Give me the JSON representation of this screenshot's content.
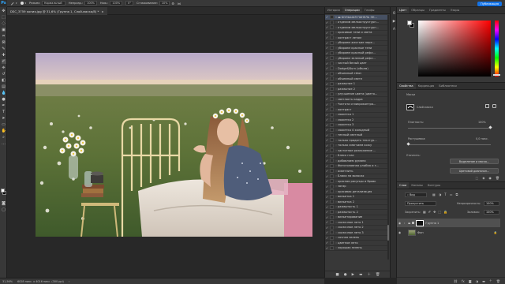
{
  "options_bar": {
    "app_logo": "Ps",
    "mode_label": "Режим:",
    "mode_value": "Нормальный",
    "opacity_label": "Непрозр.:",
    "opacity_value": "100%",
    "pressure_label": "Наж.:",
    "pressure_value": "100%",
    "angle_value": "0°",
    "smoothing_label": "Сглаживание:",
    "smoothing_value": "10%",
    "share_label": "Публикация"
  },
  "document": {
    "tab_title": "DSC_3759 копия.jpg @ 31,6% (Группа 1, Слой-маска/8) *",
    "zoom": "31,56%",
    "dimensions": "6028 пикс. x 4016 пикс. (300 ppi)"
  },
  "actions_panel": {
    "tabs": [
      "История",
      "Операции",
      "Глифы"
    ],
    "active_tab": "Операции",
    "folder_name": "БОЛЬШАЯ ПАНЕЛЬ ЭК...",
    "items": [
      "отделим мелкоструктурн...",
      "отделим мелкоструктурн...",
      "красивые тени и света",
      "контраст летом",
      "убираем жесткие пере...",
      "убираем красные тени",
      "убираем красный рефл...",
      "убираем зеленый рефл...",
      "чистый белый цвет",
      "Dodge&Burn (объем)",
      "объемный тёмн",
      "объемный светл",
      "размытие 1",
      "размытие 2",
      "улучшение цвета (цвето...",
      "светлость кадра",
      "Чистота и микроконтра...",
      "контраст",
      "сюжетка 1",
      "сюжетка 2",
      "сюжетка 3",
      "сюжетка 4 холодный",
      "теплый светлый",
      "только придать текстур...",
      "только смягчаем кожу",
      "частотное разложение ...",
      "Блеск глаз",
      "добавляем румяна",
      "Фотоголовная улыбка и з...",
      "осветлить",
      "Блики на волосах",
      "красная рисунцы и бровк",
      "загар",
      "красивая детализация",
      "виньетка 1",
      "виньетка 2",
      "размытость 1",
      "размытость 2",
      "виньетирование",
      "сказочное лето 1",
      "сказочное лето 2",
      "сказочное лето 3",
      "сочная зелень",
      "цветное лето",
      "хорошая зелень"
    ]
  },
  "color_panel": {
    "tabs": [
      "Цвет",
      "Образцы",
      "Градиенты",
      "Узоры"
    ],
    "active_tab": "Цвет",
    "hue_color": "#ff0000"
  },
  "properties_panel": {
    "tabs": [
      "Свойства",
      "Коррекция",
      "Библиотеки"
    ],
    "active_tab": "Свойства",
    "section_label": "Маски",
    "mask_label": "Слой-маска",
    "density_label": "Плотность:",
    "density_value": "100%",
    "feather_label": "Растушевка:",
    "feather_value": "0,0 пикс.",
    "refine_label": "Уточнить:",
    "select_mask_button": "Выделение и маска...",
    "color_range_button": "Цветовой диапазон..."
  },
  "layers_panel": {
    "tabs": [
      "Слои",
      "Каналы",
      "Контуры"
    ],
    "active_tab": "Слои",
    "filter_label": "Вид",
    "blend_mode": "Пропустить",
    "opacity_label": "Непрозрачность:",
    "opacity_value": "100%",
    "lock_label": "Закрепить:",
    "fill_label": "Заливка:",
    "fill_value": "100%",
    "layers": [
      {
        "name": "Группа 1",
        "type": "group"
      },
      {
        "name": "Фон",
        "type": "background"
      }
    ]
  }
}
